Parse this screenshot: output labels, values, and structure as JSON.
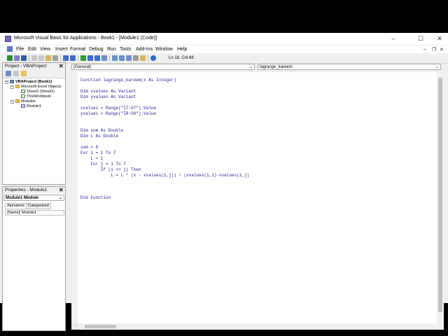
{
  "window": {
    "title": "Microsoft Visual Basic for Applications - Book1 - [Module1 (Code)]",
    "minimize": "–",
    "maximize": "☐",
    "close": "✕"
  },
  "mdi": {
    "minimize": "–",
    "restore": "❐",
    "close": "✕"
  },
  "menu": [
    "File",
    "Edit",
    "View",
    "Insert",
    "Format",
    "Debug",
    "Run",
    "Tools",
    "Add-Ins",
    "Window",
    "Help"
  ],
  "toolbar": {
    "position": "Ln 18, Col 68"
  },
  "project_panel": {
    "title": "Project - VBAProject",
    "close": "✕",
    "tree": [
      "VBAProject (Book1)",
      "Microsoft Excel Objects",
      "Sheet1 (Sheet1)",
      "ThisWorkbook",
      "Modules",
      "Module1"
    ]
  },
  "properties_panel": {
    "title": "Properties - Module1",
    "close": "✕",
    "object": "Module1 Module",
    "tabs": [
      "Alphabetic",
      "Categorized"
    ],
    "row": {
      "name": "(Name)",
      "value": "Module1"
    }
  },
  "code_window": {
    "object_select": "(General)",
    "proc_select": "lagrange_kareem",
    "lines": [
      "Function lagrange_kareem(x As Integer)",
      "",
      "Dim xvalues As Variant",
      "Dim yvalues As Variant",
      "",
      "xvalues = Range(\"I7:O7\").Value",
      "yvalues = Range(\"I8:O8\").Value",
      "",
      "",
      "Dim sum As Double",
      "Dim L As Double",
      "",
      "sum = 0",
      "For i = 1 To 7",
      "    L = 1",
      "    For j = 1 To 7",
      "        If (i <> j) Then",
      "            L = L * (x - xvalues(1,j)) / (xvalues(1,i)-xvalues(1,j)",
      "",
      "",
      "",
      "End Function"
    ]
  },
  "colors": {
    "code_text": "#1c1c8c",
    "accent": "#5a7bb8"
  }
}
